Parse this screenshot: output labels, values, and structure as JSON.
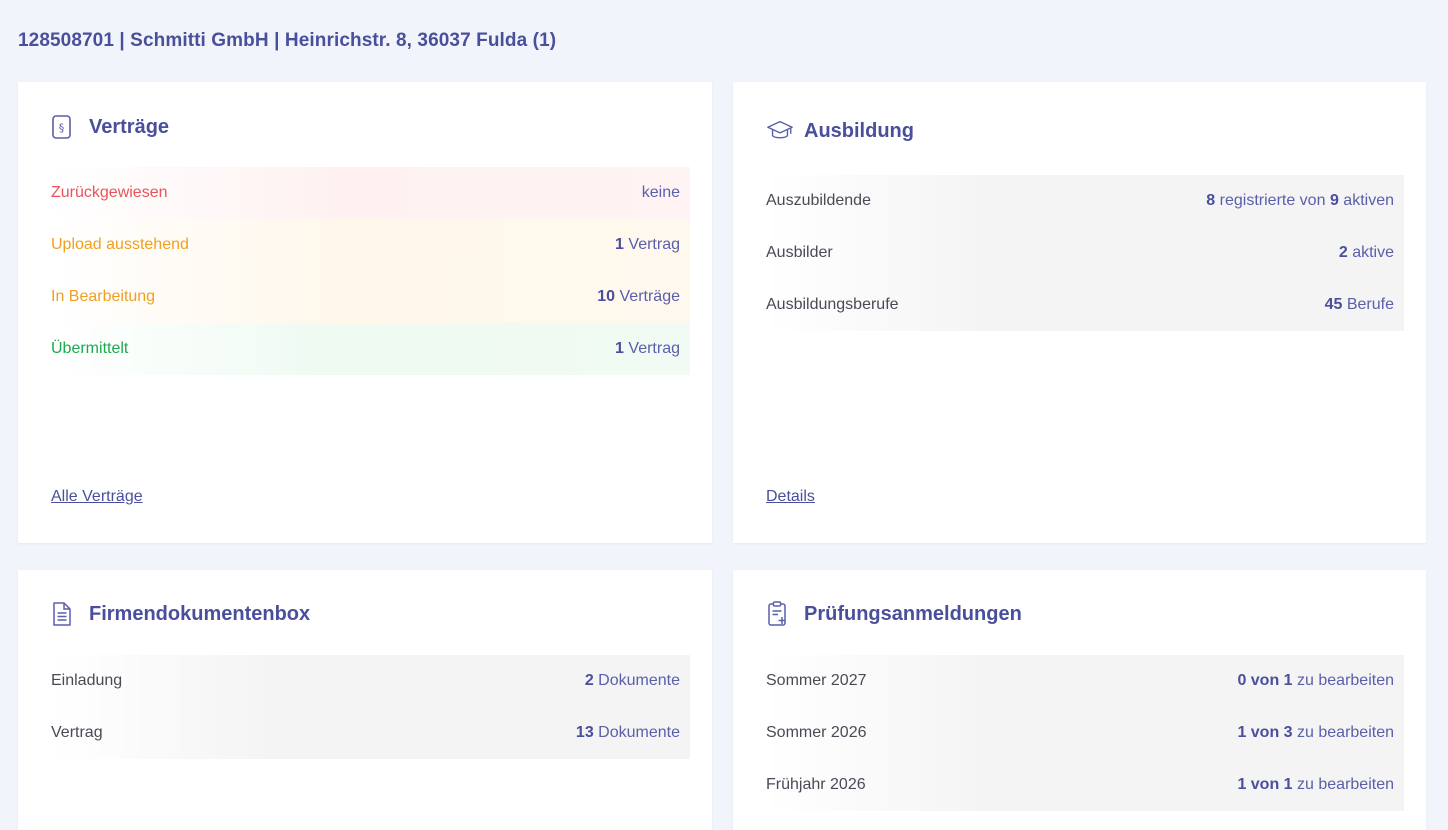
{
  "header": {
    "title": "128508701 | Schmitti GmbH | Heinrichstr. 8, 36037 Fulda (1)"
  },
  "vertraege": {
    "title": "Verträge",
    "rows": [
      {
        "label": "Zurückgewiesen",
        "num": "",
        "unit": "keine"
      },
      {
        "label": "Upload ausstehend",
        "num": "1",
        "unit": "Vertrag"
      },
      {
        "label": "In Bearbeitung",
        "num": "10",
        "unit": "Verträge"
      },
      {
        "label": "Übermittelt",
        "num": "1",
        "unit": "Vertrag"
      }
    ],
    "link": "Alle Verträge"
  },
  "ausbildung": {
    "title": "Ausbildung",
    "rows": [
      {
        "label": "Auszubildende",
        "num1": "8",
        "text1": "registrierte von",
        "num2": "9",
        "text2": "aktiven"
      },
      {
        "label": "Ausbilder",
        "num": "2",
        "unit": "aktive"
      },
      {
        "label": "Ausbildungsberufe",
        "num": "45",
        "unit": "Berufe"
      }
    ],
    "link": "Details"
  },
  "firmendokumentenbox": {
    "title": "Firmendokumentenbox",
    "rows": [
      {
        "label": "Einladung",
        "num": "2",
        "unit": "Dokumente"
      },
      {
        "label": "Vertrag",
        "num": "13",
        "unit": "Dokumente"
      }
    ]
  },
  "pruefungsanmeldungen": {
    "title": "Prüfungsanmeldungen",
    "rows": [
      {
        "label": "Sommer 2027",
        "count": "0 von 1",
        "unit": "zu bearbeiten"
      },
      {
        "label": "Sommer 2026",
        "count": "1 von 3",
        "unit": "zu bearbeiten"
      },
      {
        "label": "Frühjahr 2026",
        "count": "1 von 1",
        "unit": "zu bearbeiten"
      }
    ]
  },
  "colors": {
    "accent": "#4a4f9c",
    "rejected": "#e8545a",
    "pending": "#f0a020",
    "submitted": "#1fa84f",
    "background": "#f1f5fb"
  }
}
